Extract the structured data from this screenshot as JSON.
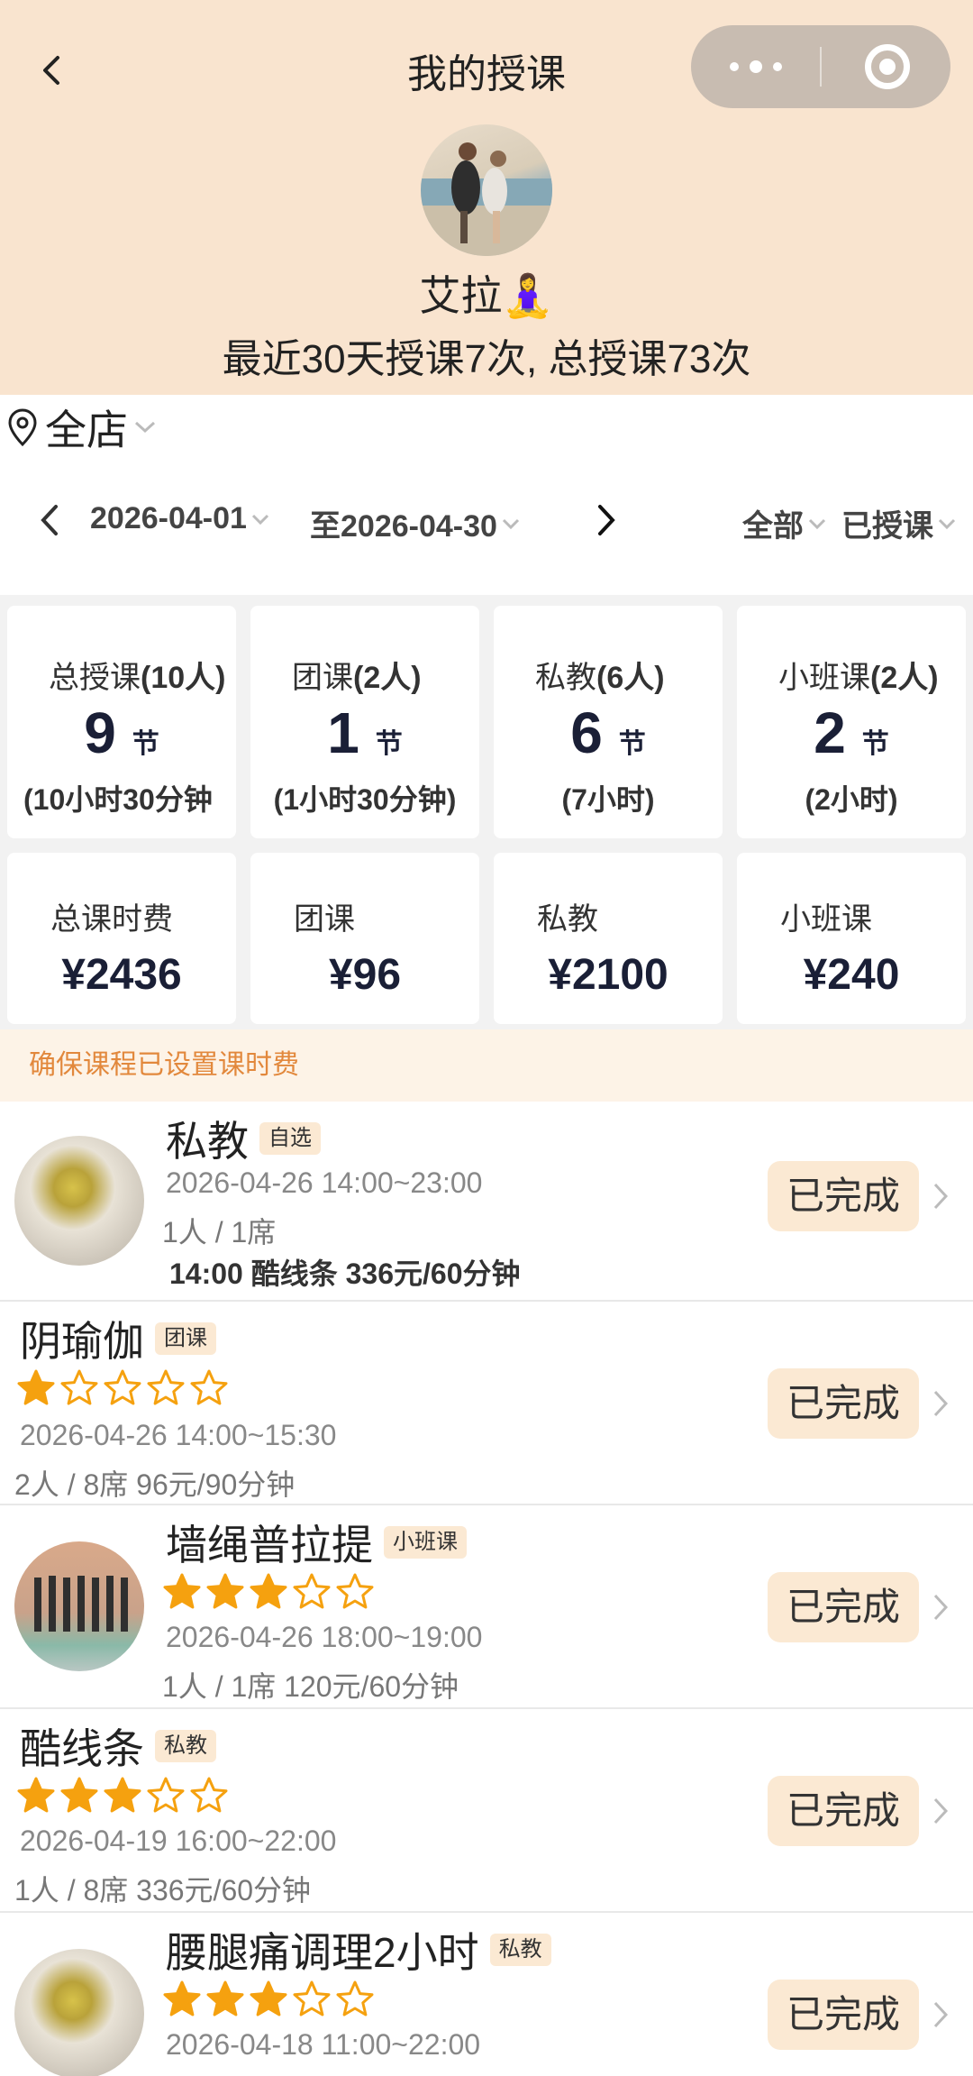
{
  "header": {
    "title": "我的授课",
    "username": "艾拉🧘‍♀️",
    "summary": "最近30天授课7次, 总授课73次"
  },
  "store": {
    "label": "全店"
  },
  "date_range": {
    "start": "2026-04-01",
    "end": "至2026-04-30",
    "filter_type": "全部",
    "filter_status": "已授课"
  },
  "stats": [
    {
      "label": "总授课",
      "count": "(10人)",
      "value": "9",
      "unit": "节",
      "duration": "(10小时30分钟"
    },
    {
      "label": "团课",
      "count": "(2人)",
      "value": "1",
      "unit": "节",
      "duration": "(1小时30分钟)"
    },
    {
      "label": "私教",
      "count": "(6人)",
      "value": "6",
      "unit": "节",
      "duration": "(7小时)"
    },
    {
      "label": "小班课",
      "count": "(2人)",
      "value": "2",
      "unit": "节",
      "duration": "(2小时)"
    }
  ],
  "fees": [
    {
      "label": "总课时费",
      "value": "¥2436"
    },
    {
      "label": "团课",
      "value": "¥96"
    },
    {
      "label": "私教",
      "value": "¥2100"
    },
    {
      "label": "小班课",
      "value": "¥240"
    }
  ],
  "notice": "确保课程已设置课时费",
  "classes": [
    {
      "name": "私教",
      "tag": "自选",
      "time": "2026-04-26 14:00~23:00",
      "seats": "1人 / 1席",
      "price": "14:00 酷线条 336元/60分钟",
      "rating": 0,
      "status": "已完成"
    },
    {
      "name": "阴瑜伽",
      "tag": "团课",
      "time": "2026-04-26 14:00~15:30",
      "seats": "2人 / 8席 96元/90分钟",
      "rating": 1,
      "status": "已完成"
    },
    {
      "name": "墙绳普拉提",
      "tag": "小班课",
      "time": "2026-04-26 18:00~19:00",
      "seats": "1人 / 1席 120元/60分钟",
      "rating": 3,
      "status": "已完成"
    },
    {
      "name": "酷线条",
      "tag": "私教",
      "time": "2026-04-19 16:00~22:00",
      "seats": "1人 / 8席 336元/60分钟",
      "rating": 3,
      "status": "已完成"
    },
    {
      "name": "腰腿痛调理2小时",
      "tag": "私教",
      "time": "2026-04-18 11:00~22:00",
      "rating": 3,
      "status": "已完成"
    }
  ],
  "colors": {
    "header_bg": "#f9e4cf",
    "accent_orange": "#f5a10f",
    "notice_text": "#e2883c",
    "badge_bg": "#fbe9d3"
  }
}
